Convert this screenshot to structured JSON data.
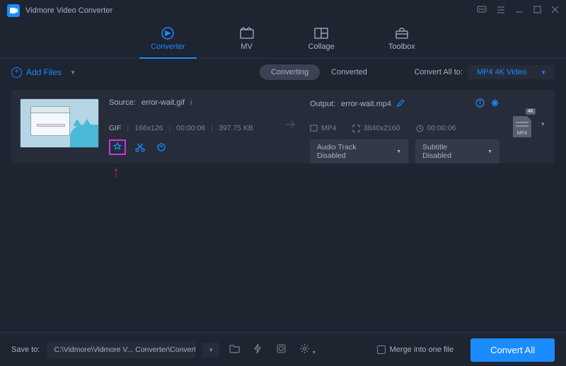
{
  "app": {
    "title": "Vidmore Video Converter"
  },
  "tabs": {
    "converter": "Converter",
    "mv": "MV",
    "collage": "Collage",
    "toolbox": "Toolbox"
  },
  "toolbar": {
    "add_files": "Add Files",
    "segment_converting": "Converting",
    "segment_converted": "Converted",
    "convert_all_label": "Convert All to:",
    "convert_all_format": "MP4 4K Video"
  },
  "item": {
    "source_label": "Source:",
    "source_name": "error-wait.gif",
    "format": "GIF",
    "dimensions": "166x126",
    "duration": "00:00:06",
    "size": "397.75 KB",
    "output_label": "Output:",
    "output_name": "error-wait.mp4",
    "out_format": "MP4",
    "out_dimensions": "3840x2160",
    "out_duration": "00:00:06",
    "audio_track": "Audio Track Disabled",
    "subtitle": "Subtitle Disabled",
    "badge_quality": "4K",
    "badge_ext": "MP4"
  },
  "footer": {
    "save_to_label": "Save to:",
    "save_path": "C:\\Vidmore\\Vidmore V... Converter\\Converted",
    "merge_label": "Merge into one file",
    "convert_btn": "Convert All"
  }
}
